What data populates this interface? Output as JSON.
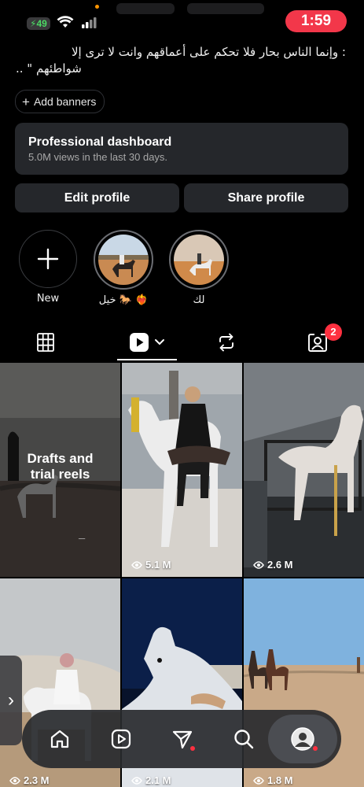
{
  "status_bar": {
    "battery": "49",
    "time": "1:59"
  },
  "profile": {
    "bio_line1": ": وإنما الناس بحار فلا تحكم على أعماقهم وانت لا ترى إلا",
    "bio_line2": "شواطئهم \" ..",
    "add_banners_label": "Add banners"
  },
  "dashboard": {
    "title": "Professional dashboard",
    "subtitle": "5.0M views in the last 30 days."
  },
  "actions": {
    "edit_label": "Edit profile",
    "share_label": "Share profile"
  },
  "highlights": [
    {
      "label": "New"
    },
    {
      "label": "خيل 🐎 ❤️‍🔥"
    },
    {
      "label": "لك"
    }
  ],
  "tabs": {
    "tagged_badge": "2"
  },
  "grid": {
    "drafts_label": "Drafts and trial reels",
    "items": [
      {
        "views": "5.1 M"
      },
      {
        "views": "2.6 M"
      },
      {
        "views": "2.3 M"
      },
      {
        "views": "2.1 M"
      },
      {
        "views": "1.8 M"
      }
    ]
  },
  "colors": {
    "time_pill": "#f2374a",
    "badge": "#ff3040",
    "battery": "#4cd964"
  }
}
